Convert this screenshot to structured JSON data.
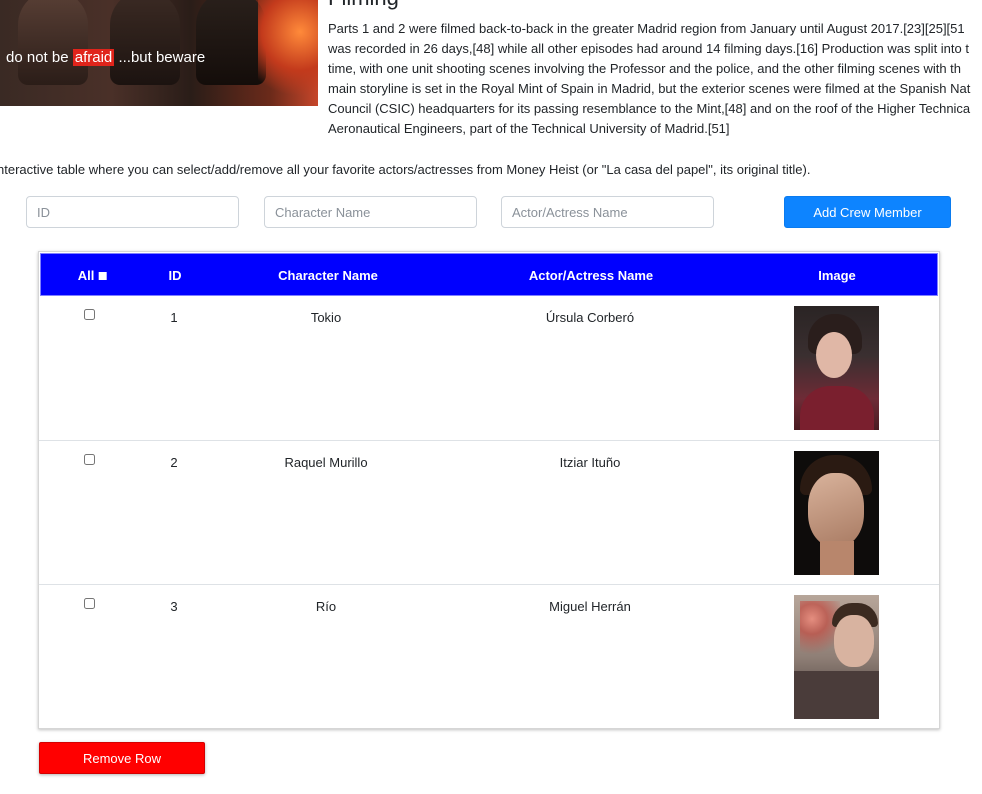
{
  "poster": {
    "tagline_pre": "do not be",
    "tagline_highlight": "afraid",
    "tagline_post": "...but beware",
    "highlight_color": "#e0241b"
  },
  "filming": {
    "heading": "Filming",
    "lines": [
      "Parts 1 and 2 were filmed back-to-back in the greater Madrid region from January until August 2017.[23][25][51",
      "was recorded in 26 days,[48] while all other episodes had around 14 filming days.[16] Production was split into t",
      "time, with one unit shooting scenes involving the Professor and the police, and the other filming scenes with th",
      "main storyline is set in the Royal Mint of Spain in Madrid, but the exterior scenes were filmed at the Spanish Nat",
      "Council (CSIC) headquarters for its passing resemblance to the Mint,[48] and on the roof of the Higher Technica",
      "Aeronautical Engineers, part of the Technical University of Madrid.[51]"
    ]
  },
  "intro": "nteractive table where you can select/add/remove all your favorite actors/actresses from Money Heist (or \"La casa del papel\", its original title).",
  "form": {
    "id_placeholder": "ID",
    "character_placeholder": "Character Name",
    "actor_placeholder": "Actor/Actress Name",
    "add_label": "Add Crew Member"
  },
  "table": {
    "headers": {
      "all": "All",
      "id": "ID",
      "character": "Character Name",
      "actor": "Actor/Actress Name",
      "image": "Image"
    },
    "rows": [
      {
        "id": "1",
        "character": "Tokio",
        "actor": "Úrsula Corberó",
        "image": "portrait-photo"
      },
      {
        "id": "2",
        "character": "Raquel Murillo",
        "actor": "Itziar Ituño",
        "image": "portrait-photo"
      },
      {
        "id": "3",
        "character": "Río",
        "actor": "Miguel Herrán",
        "image": "portrait-photo"
      }
    ]
  },
  "remove_label": "Remove Row",
  "colors": {
    "header_blue": "#0000ff",
    "add_button": "#0d84ff",
    "remove_button": "#ff0000"
  }
}
